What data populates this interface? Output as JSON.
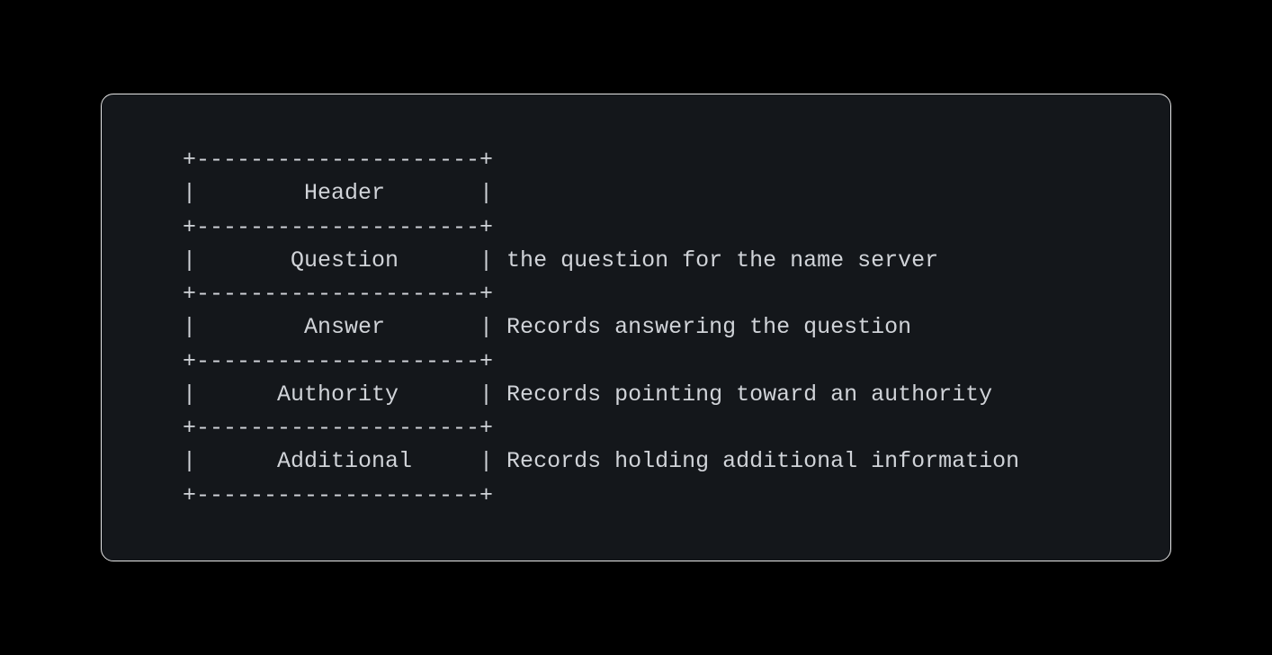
{
  "diagram": {
    "lines": [
      "+---------------------+",
      "|        Header       |",
      "+---------------------+",
      "|       Question      | the question for the name server",
      "+---------------------+",
      "|        Answer       | Records answering the question",
      "+---------------------+",
      "|      Authority      | Records pointing toward an authority",
      "+---------------------+",
      "|      Additional     | Records holding additional information",
      "+---------------------+"
    ]
  }
}
